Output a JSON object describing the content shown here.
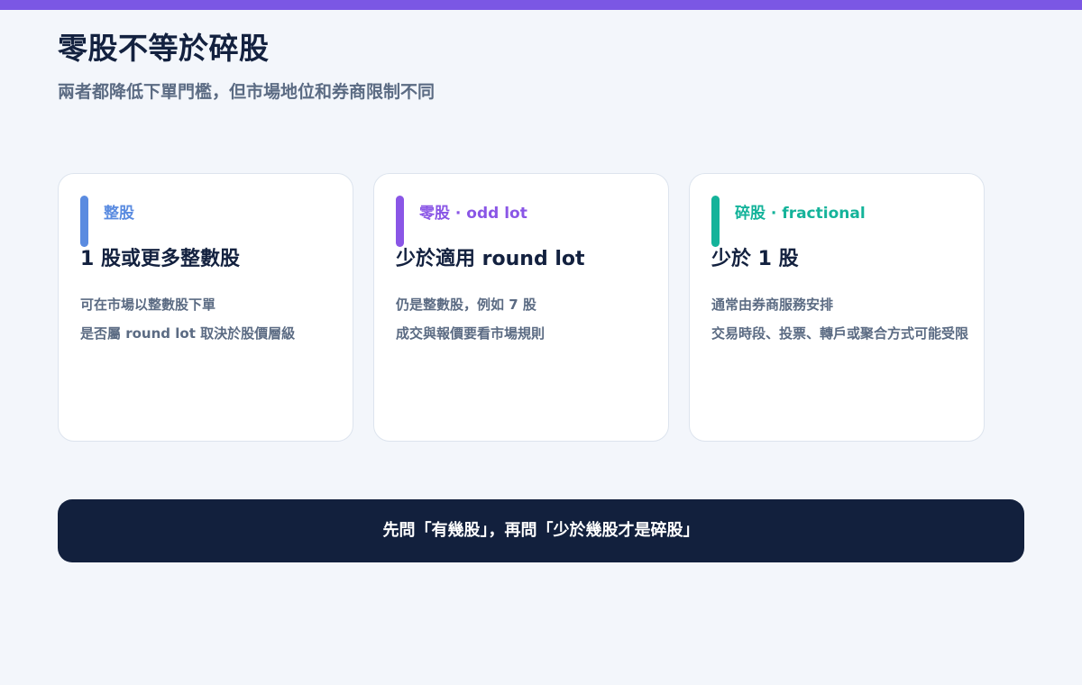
{
  "header": {
    "title": "零股不等於碎股",
    "subtitle": "兩者都降低下單門檻，但市場地位和券商限制不同"
  },
  "cards": [
    {
      "tag": "整股",
      "heading": "1 股或更多整數股",
      "lines": [
        "可在市場以整數股下單",
        "是否屬 round lot 取決於股價層級"
      ],
      "accent": "#5a8be0"
    },
    {
      "tag": "零股 · odd lot",
      "heading": "少於適用 round lot",
      "lines": [
        "仍是整數股，例如 7 股",
        "成交與報價要看市場規則"
      ],
      "accent": "#8a56e6"
    },
    {
      "tag": "碎股 · fractional",
      "heading": "少於 1 股",
      "lines": [
        "通常由券商服務安排",
        "交易時段、投票、轉戶或聚合方式可能受限"
      ],
      "accent": "#14b39a"
    }
  ],
  "banner": {
    "text": "先問「有幾股」，再問「少於幾股才是碎股」"
  },
  "colors": {
    "top_bar": "#7b57e4",
    "background": "#f3f6fb",
    "banner_bg": "#12203d"
  }
}
